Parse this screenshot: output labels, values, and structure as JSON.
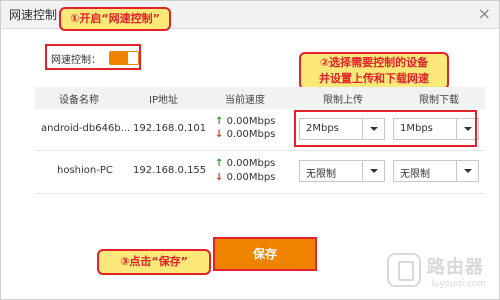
{
  "window": {
    "title": "网速控制",
    "close_glyph": "×"
  },
  "speed_control": {
    "label": "网速控制：",
    "enabled": true
  },
  "callouts": {
    "step1": "①开启“网速控制”",
    "step2_line1": "②选择需要控制的设备",
    "step2_line2": "并设置上传和下载网速",
    "step3": "③点击“保存”"
  },
  "table": {
    "headers": [
      "设备名称",
      "IP地址",
      "当前速度",
      "限制上传",
      "限制下载"
    ],
    "rows": [
      {
        "device": "android-db646b...",
        "ip": "192.168.0.101",
        "up_speed": "0.00Mbps",
        "down_speed": "0.00Mbps",
        "upload_limit": "2Mbps",
        "download_limit": "1Mbps"
      },
      {
        "device": "hoshion-PC",
        "ip": "192.168.0.155",
        "up_speed": "0.00Mbps",
        "down_speed": "0.00Mbps",
        "upload_limit": "无限制",
        "download_limit": "无限制"
      }
    ]
  },
  "save_label": "保存",
  "watermark": {
    "text": "路由器",
    "sub": "luyouqi.com"
  },
  "colors": {
    "accent": "#f08300",
    "highlight": "#e3232b",
    "callout_bg": "#fde97a"
  },
  "icons": {
    "up": "arrow-up-icon",
    "down": "arrow-down-icon",
    "dropdown": "chevron-down-icon"
  }
}
